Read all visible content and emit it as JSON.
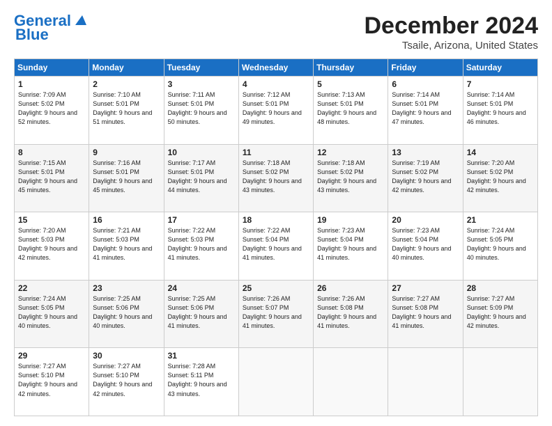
{
  "header": {
    "logo_line1": "General",
    "logo_line2": "Blue",
    "title": "December 2024",
    "subtitle": "Tsaile, Arizona, United States"
  },
  "calendar": {
    "days_of_week": [
      "Sunday",
      "Monday",
      "Tuesday",
      "Wednesday",
      "Thursday",
      "Friday",
      "Saturday"
    ],
    "weeks": [
      [
        null,
        {
          "day": "1",
          "sunrise": "7:09 AM",
          "sunset": "5:02 PM",
          "daylight": "9 hours and 52 minutes."
        },
        {
          "day": "2",
          "sunrise": "7:10 AM",
          "sunset": "5:01 PM",
          "daylight": "9 hours and 51 minutes."
        },
        {
          "day": "3",
          "sunrise": "7:11 AM",
          "sunset": "5:01 PM",
          "daylight": "9 hours and 50 minutes."
        },
        {
          "day": "4",
          "sunrise": "7:12 AM",
          "sunset": "5:01 PM",
          "daylight": "9 hours and 49 minutes."
        },
        {
          "day": "5",
          "sunrise": "7:13 AM",
          "sunset": "5:01 PM",
          "daylight": "9 hours and 48 minutes."
        },
        {
          "day": "6",
          "sunrise": "7:14 AM",
          "sunset": "5:01 PM",
          "daylight": "9 hours and 47 minutes."
        },
        {
          "day": "7",
          "sunrise": "7:14 AM",
          "sunset": "5:01 PM",
          "daylight": "9 hours and 46 minutes."
        }
      ],
      [
        {
          "day": "8",
          "sunrise": "7:15 AM",
          "sunset": "5:01 PM",
          "daylight": "9 hours and 45 minutes."
        },
        {
          "day": "9",
          "sunrise": "7:16 AM",
          "sunset": "5:01 PM",
          "daylight": "9 hours and 45 minutes."
        },
        {
          "day": "10",
          "sunrise": "7:17 AM",
          "sunset": "5:01 PM",
          "daylight": "9 hours and 44 minutes."
        },
        {
          "day": "11",
          "sunrise": "7:18 AM",
          "sunset": "5:02 PM",
          "daylight": "9 hours and 43 minutes."
        },
        {
          "day": "12",
          "sunrise": "7:18 AM",
          "sunset": "5:02 PM",
          "daylight": "9 hours and 43 minutes."
        },
        {
          "day": "13",
          "sunrise": "7:19 AM",
          "sunset": "5:02 PM",
          "daylight": "9 hours and 42 minutes."
        },
        {
          "day": "14",
          "sunrise": "7:20 AM",
          "sunset": "5:02 PM",
          "daylight": "9 hours and 42 minutes."
        }
      ],
      [
        {
          "day": "15",
          "sunrise": "7:20 AM",
          "sunset": "5:03 PM",
          "daylight": "9 hours and 42 minutes."
        },
        {
          "day": "16",
          "sunrise": "7:21 AM",
          "sunset": "5:03 PM",
          "daylight": "9 hours and 41 minutes."
        },
        {
          "day": "17",
          "sunrise": "7:22 AM",
          "sunset": "5:03 PM",
          "daylight": "9 hours and 41 minutes."
        },
        {
          "day": "18",
          "sunrise": "7:22 AM",
          "sunset": "5:04 PM",
          "daylight": "9 hours and 41 minutes."
        },
        {
          "day": "19",
          "sunrise": "7:23 AM",
          "sunset": "5:04 PM",
          "daylight": "9 hours and 41 minutes."
        },
        {
          "day": "20",
          "sunrise": "7:23 AM",
          "sunset": "5:04 PM",
          "daylight": "9 hours and 40 minutes."
        },
        {
          "day": "21",
          "sunrise": "7:24 AM",
          "sunset": "5:05 PM",
          "daylight": "9 hours and 40 minutes."
        }
      ],
      [
        {
          "day": "22",
          "sunrise": "7:24 AM",
          "sunset": "5:05 PM",
          "daylight": "9 hours and 40 minutes."
        },
        {
          "day": "23",
          "sunrise": "7:25 AM",
          "sunset": "5:06 PM",
          "daylight": "9 hours and 40 minutes."
        },
        {
          "day": "24",
          "sunrise": "7:25 AM",
          "sunset": "5:06 PM",
          "daylight": "9 hours and 41 minutes."
        },
        {
          "day": "25",
          "sunrise": "7:26 AM",
          "sunset": "5:07 PM",
          "daylight": "9 hours and 41 minutes."
        },
        {
          "day": "26",
          "sunrise": "7:26 AM",
          "sunset": "5:08 PM",
          "daylight": "9 hours and 41 minutes."
        },
        {
          "day": "27",
          "sunrise": "7:27 AM",
          "sunset": "5:08 PM",
          "daylight": "9 hours and 41 minutes."
        },
        {
          "day": "28",
          "sunrise": "7:27 AM",
          "sunset": "5:09 PM",
          "daylight": "9 hours and 42 minutes."
        }
      ],
      [
        {
          "day": "29",
          "sunrise": "7:27 AM",
          "sunset": "5:10 PM",
          "daylight": "9 hours and 42 minutes."
        },
        {
          "day": "30",
          "sunrise": "7:27 AM",
          "sunset": "5:10 PM",
          "daylight": "9 hours and 42 minutes."
        },
        {
          "day": "31",
          "sunrise": "7:28 AM",
          "sunset": "5:11 PM",
          "daylight": "9 hours and 43 minutes."
        },
        null,
        null,
        null,
        null
      ]
    ]
  }
}
